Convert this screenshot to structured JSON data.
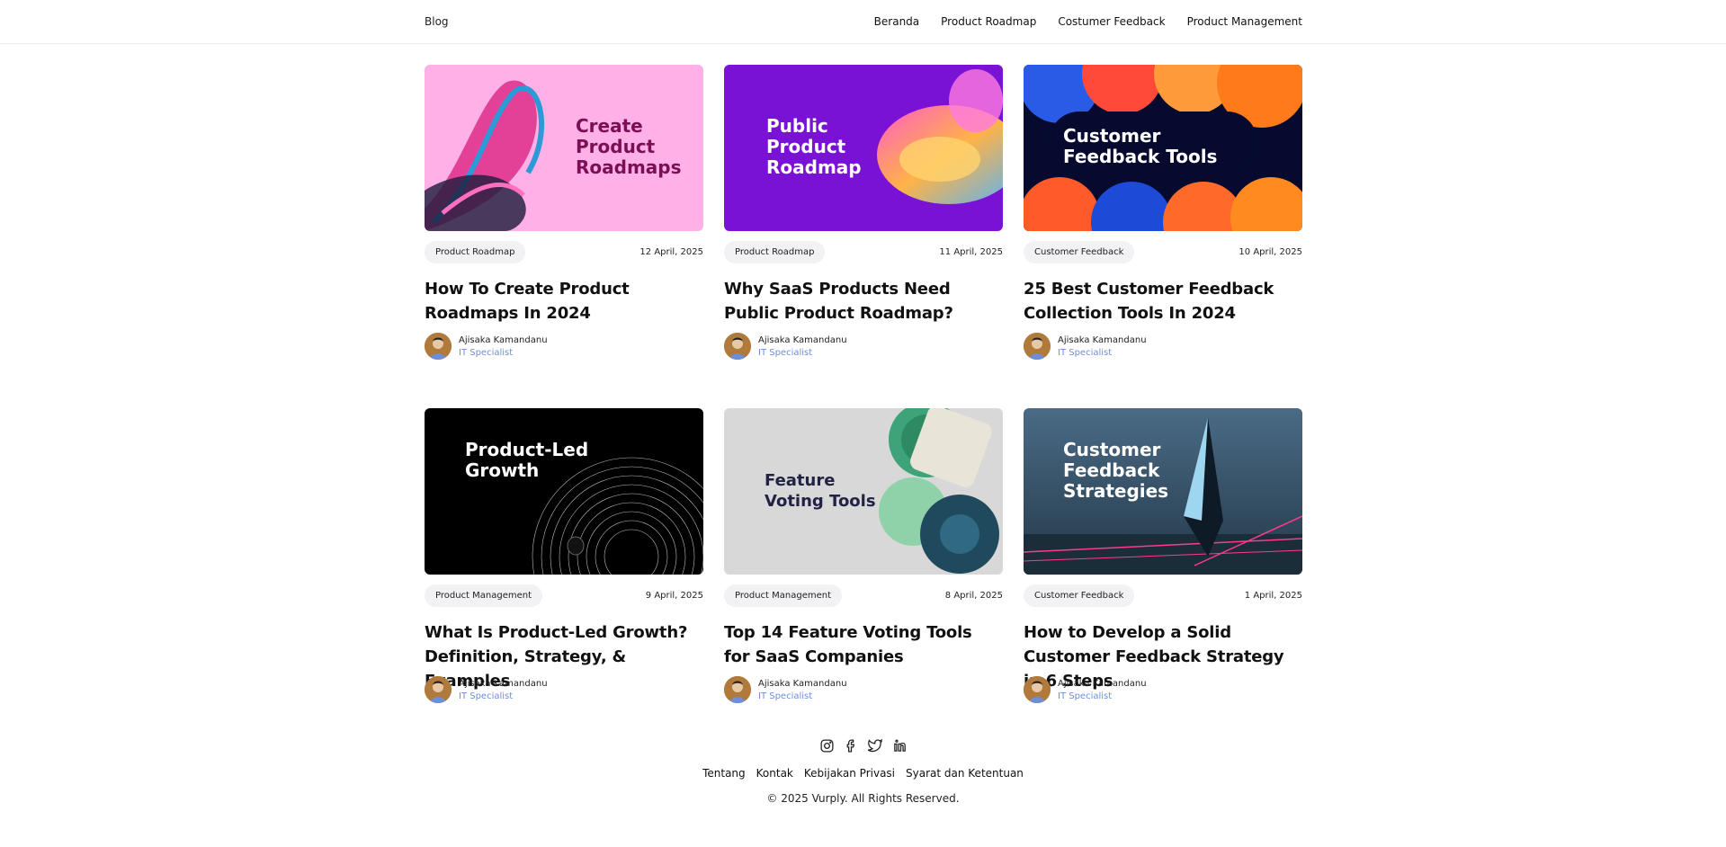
{
  "header": {
    "brand": "Blog",
    "nav": [
      "Beranda",
      "Product Roadmap",
      "Costumer Feedback",
      "Product Management"
    ]
  },
  "posts": [
    {
      "thumb_text": "Create\nProduct\nRoadmaps",
      "category": "Product Roadmap",
      "date": "12 April, 2025",
      "title": "How To Create Product Roadmaps In 2024",
      "author": "Ajisaka Kamandanu",
      "role": "IT Specialist"
    },
    {
      "thumb_text": "Public\nProduct\nRoadmap",
      "category": "Product Roadmap",
      "date": "11 April, 2025",
      "title": "Why SaaS Products Need Public Product Roadmap?",
      "author": "Ajisaka Kamandanu",
      "role": "IT Specialist"
    },
    {
      "thumb_text": "Customer\nFeedback Tools",
      "category": "Customer Feedback",
      "date": "10 April, 2025",
      "title": "25 Best Customer Feedback Collection Tools In 2024",
      "author": "Ajisaka Kamandanu",
      "role": "IT Specialist"
    },
    {
      "thumb_text": "Product-Led\nGrowth",
      "category": "Product Management",
      "date": "9 April, 2025",
      "title": "What Is Product-Led Growth? Definition, Strategy, & Examples",
      "author": "Ajisaka Kamandanu",
      "role": "IT Specialist"
    },
    {
      "thumb_text": "Feature\nVoting Tools",
      "category": "Product Management",
      "date": "8 April, 2025",
      "title": "Top 14 Feature Voting Tools for SaaS Companies",
      "author": "Ajisaka Kamandanu",
      "role": "IT Specialist"
    },
    {
      "thumb_text": "Customer\nFeedback\nStrategies",
      "category": "Customer Feedback",
      "date": "1 April, 2025",
      "title": "How to Develop a Solid Customer Feedback Strategy in 6 Steps",
      "author": "Ajisaka Kamandanu",
      "role": "IT Specialist"
    }
  ],
  "footer": {
    "social_icons": [
      "instagram-icon",
      "facebook-icon",
      "twitter-icon",
      "linkedin-icon"
    ],
    "links": [
      "Tentang",
      "Kontak",
      "Kebijakan Privasi",
      "Syarat dan Ketentuan"
    ],
    "copyright": "© 2025 Vurply. All Rights Reserved."
  },
  "colors": {
    "role_text": "#6f8ed6",
    "chip_bg": "#f2f2f4",
    "thumb1_bg": "#ffb0e6",
    "thumb2_bg": "#7a12d6",
    "thumb3_bg": "#050a2e",
    "thumb4_bg": "#000000",
    "thumb5_bg": "#d8d8d8",
    "thumb6_bg": "#3d5a72"
  }
}
